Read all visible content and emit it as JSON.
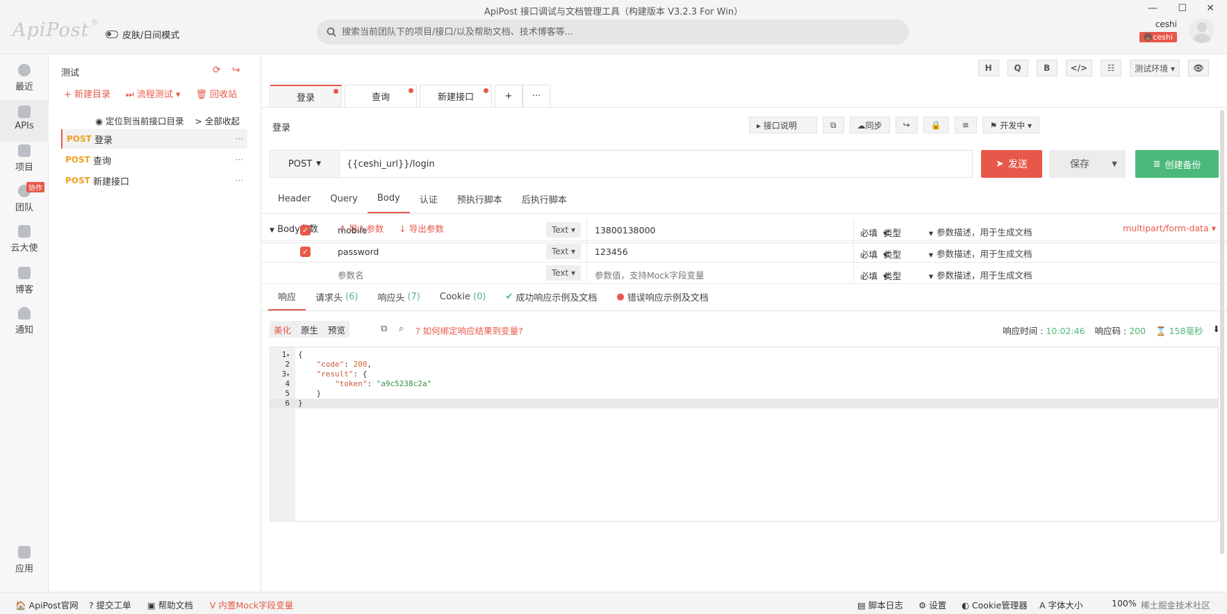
{
  "window": {
    "title": "ApiPost 接口调试与文档管理工具（构建版本 V3.2.3 For Win）"
  },
  "header": {
    "logo": "ApiPost",
    "logo_mark": "®",
    "skin_label": "皮肤/日间模式",
    "search_placeholder": "搜索当前团队下的项目/接口/以及帮助文档、技术博客等...",
    "user_name": "ceshi",
    "user_badge": "ceshi"
  },
  "rail": {
    "items": [
      {
        "label": "最近",
        "icon": "clock-icon"
      },
      {
        "label": "APIs",
        "icon": "terminal-icon"
      },
      {
        "label": "项目",
        "icon": "project-icon"
      },
      {
        "label": "团队",
        "icon": "team-icon",
        "badge": "协作"
      },
      {
        "label": "云大使",
        "icon": "graduation-icon"
      },
      {
        "label": "博客",
        "icon": "edit-icon"
      },
      {
        "label": "通知",
        "icon": "bell-icon"
      },
      {
        "label": "应用",
        "icon": "grid-icon"
      }
    ]
  },
  "tree": {
    "project_name": "测试",
    "actions": [
      "+ 新建目录",
      "⏭ 流程测试 ▾",
      "🗑 回收站"
    ],
    "locate": "定位到当前接口目录",
    "collapse": "> 全部收起",
    "apis": [
      {
        "method": "POST",
        "name": "登录"
      },
      {
        "method": "POST",
        "name": "查询"
      },
      {
        "method": "POST",
        "name": "新建接口"
      }
    ]
  },
  "toolbar": {
    "buttons": [
      "H",
      "Q",
      "B",
      "</>",
      "☷"
    ],
    "env": "测试环境 ▾"
  },
  "tabs": [
    {
      "label": "登录"
    },
    {
      "label": "查询"
    },
    {
      "label": "新建接口"
    }
  ],
  "tab_add": "+",
  "tab_more": "···",
  "api": {
    "name": "登录",
    "tools": [
      "▸ 接口说明",
      "⧉",
      "☁同步",
      "↪",
      "🔒",
      "≡",
      "⚑ 开发中 ▾"
    ],
    "method": "POST",
    "url": "{{ceshi_url}}/login",
    "send": "发送",
    "save": "保存",
    "backup": "创建备份"
  },
  "request_tabs": [
    "Header",
    "Query",
    "Body",
    "认证",
    "预执行脚本",
    "后执行脚本"
  ],
  "body": {
    "label": "Body参数",
    "import": "导入参数",
    "export": "导出参数",
    "content_type": "multipart/form-data",
    "params": [
      {
        "name": "mobile",
        "type": "Text",
        "value": "13800138000",
        "required": "必填",
        "kind": "类型",
        "desc": "参数描述，用于生成文档",
        "checked": true
      },
      {
        "name": "password",
        "type": "Text",
        "value": "123456",
        "required": "必填",
        "kind": "类型",
        "desc": "参数描述，用于生成文档",
        "checked": true
      },
      {
        "name": "参数名",
        "type": "Text",
        "value": "参数值，支持Mock字段变量",
        "required": "必填",
        "kind": "类型",
        "desc": "参数描述，用于生成文档",
        "checked": false
      }
    ]
  },
  "response": {
    "tabs": [
      {
        "label": "响应",
        "count": ""
      },
      {
        "label": "请求头",
        "count": "(6)"
      },
      {
        "label": "响应头",
        "count": "(7)"
      },
      {
        "label": "Cookie",
        "count": "(0)"
      },
      {
        "label": "成功响应示例及文档",
        "count": ""
      },
      {
        "label": "错误响应示例及文档",
        "count": ""
      }
    ],
    "views": [
      "美化",
      "原生",
      "预览"
    ],
    "help": "如何绑定响应结果到变量?",
    "time_label": "响应时间 :",
    "time_value": "10:02:46",
    "code_label": "响应码 :",
    "code_value": "200",
    "duration": "158毫秒"
  },
  "editor": {
    "lines": [
      {
        "num": "1",
        "fold": "▾",
        "text": "{"
      },
      {
        "num": "2",
        "fold": "",
        "key": "\"code\"",
        "sep": ": ",
        "val": "200",
        "tail": ","
      },
      {
        "num": "3",
        "fold": "▾",
        "key": "\"result\"",
        "sep": ": ",
        "tail": "{"
      },
      {
        "num": "4",
        "fold": "",
        "key": "\"token\"",
        "sep": ": ",
        "str": "\"a9c5238c2a\""
      },
      {
        "num": "5",
        "fold": "",
        "text": "    }"
      },
      {
        "num": "6",
        "fold": "",
        "text": "}"
      }
    ]
  },
  "footer": {
    "left": [
      "🏠 ApiPost官网",
      "? 提交工单",
      "▣ 帮助文档",
      "V 内置Mock字段变量"
    ],
    "right": [
      "▤ 脚本日志",
      "⚙ 设置",
      "◐ Cookie管理器",
      "A 字体大小",
      "100%",
      "稀土掘金技术社区"
    ]
  },
  "colors": {
    "accent": "#e8584a",
    "success": "#4cb97a",
    "method": "#f0a020"
  }
}
